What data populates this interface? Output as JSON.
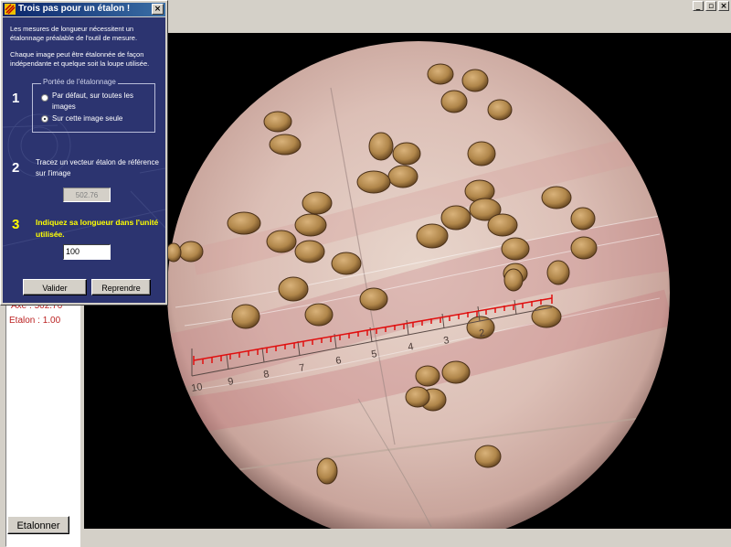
{
  "dialog": {
    "title": "Trois pas pour un étalon !",
    "intro_1": "Les mesures de longueur nécessitent un étalonnage préalable de l'outil de mesure.",
    "intro_2": "Chaque image peut être étalonnée de façon indépendante et quelque soit la loupe utilisée.",
    "step1_number": "1",
    "scope_group_label": "Portée de l'étalonnage",
    "radio_default": "Par défaut, sur toutes les images",
    "radio_this_image": "Sur cette image seule",
    "radio_selected": "radio_this_image",
    "step2_number": "2",
    "step2_text": "Tracez un vecteur étalon de référence sur l'image",
    "reference_value": "502.76",
    "step3_number": "3",
    "step3_text": "Indiquez sa longueur dans l'unité utilisée.",
    "length_value": "100",
    "validate_button": "Valider",
    "restart_button": "Reprendre",
    "close_button": "×"
  },
  "left_panel": {
    "axe_text": "Axe : 502.76",
    "etalon_text": "Etalon : 1.00",
    "etalonner_button": "Etalonner"
  },
  "window_buttons": {
    "minimize": "_",
    "maximize": "▫",
    "close": "×"
  },
  "scale_ruler": {
    "labels": [
      "10",
      "9",
      "8",
      "7",
      "6",
      "5",
      "4",
      "3",
      "2"
    ]
  },
  "colors": {
    "dialog_background": "#2c3470",
    "step3_highlight": "#ffff00",
    "calibration_line": "#e01010",
    "info_text": "#b22222"
  }
}
